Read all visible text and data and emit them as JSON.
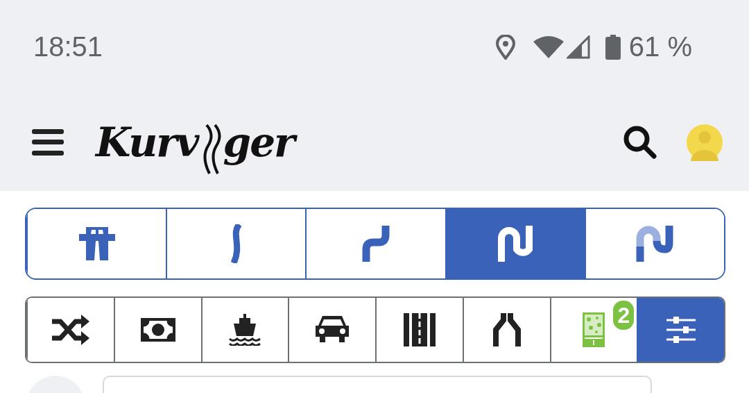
{
  "status_bar": {
    "time": "18:51",
    "battery": "61 %"
  },
  "header": {
    "logo_start": "Kurv",
    "logo_end": "ger"
  },
  "curviness_tabs": [
    {
      "kind": "highway",
      "selected": false
    },
    {
      "kind": "slight",
      "selected": false
    },
    {
      "kind": "curvy",
      "selected": false
    },
    {
      "kind": "very-curvy",
      "selected": true
    },
    {
      "kind": "custom",
      "selected": false
    }
  ],
  "options": [
    {
      "kind": "shuffle",
      "selected": false
    },
    {
      "kind": "toll",
      "selected": false
    },
    {
      "kind": "ferry",
      "selected": false
    },
    {
      "kind": "car",
      "selected": false
    },
    {
      "kind": "road",
      "selected": false
    },
    {
      "kind": "narrow",
      "selected": false
    },
    {
      "kind": "green-zone",
      "selected": false,
      "badge": "2"
    },
    {
      "kind": "settings",
      "selected": true
    }
  ]
}
